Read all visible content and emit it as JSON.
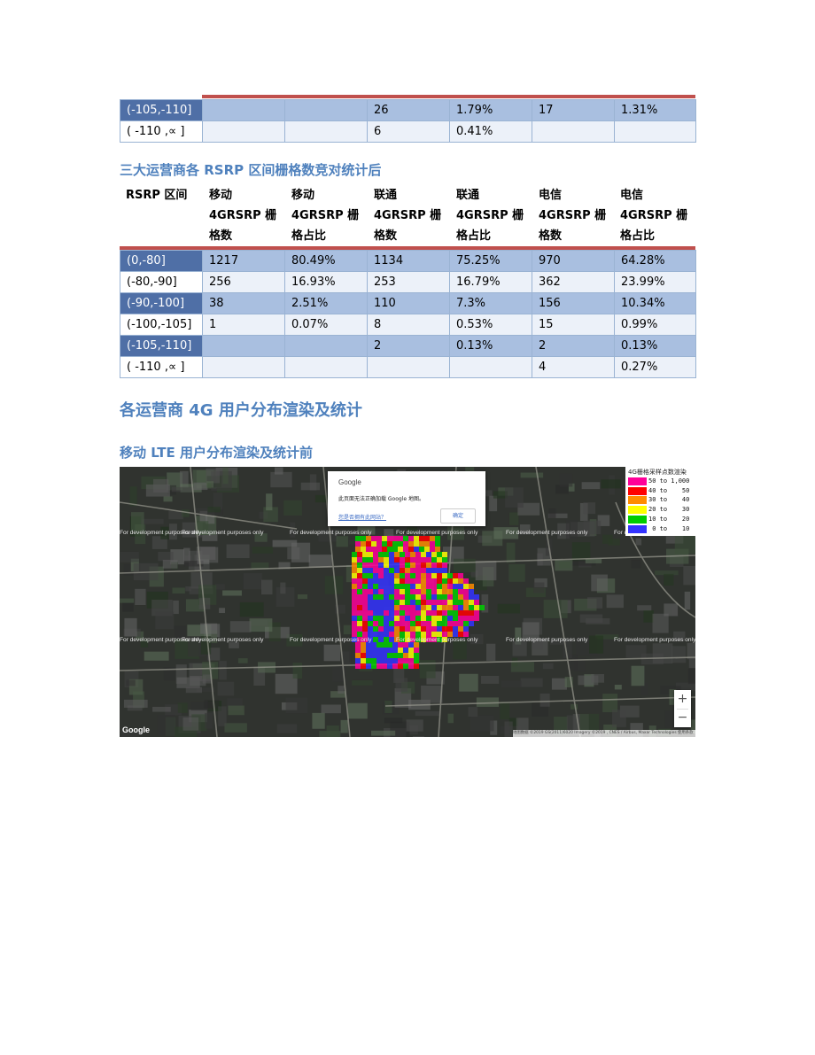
{
  "table1": {
    "rows": [
      [
        "(-105,-110]",
        "",
        "",
        "26",
        "1.79%",
        "17",
        "1.31%"
      ],
      [
        "( -110 ,∝  ]",
        "",
        "",
        "6",
        "0.41%",
        "",
        ""
      ]
    ]
  },
  "heading1": "三大运营商各 RSRP 区间栅格数竞对统计后",
  "table2": {
    "headers": [
      [
        "RSRP 区间"
      ],
      [
        "移动",
        "4GRSRP 栅",
        "格数"
      ],
      [
        "移动",
        "4GRSRP 栅",
        "格占比"
      ],
      [
        "联通",
        "4GRSRP 栅",
        "格数"
      ],
      [
        "联通",
        "4GRSRP 栅",
        "格占比"
      ],
      [
        "电信",
        "4GRSRP 栅",
        "格数"
      ],
      [
        "电信",
        "4GRSRP 栅",
        "格占比"
      ]
    ],
    "rows": [
      [
        "(0,-80]",
        "1217",
        "80.49%",
        "1134",
        "75.25%",
        "970",
        "64.28%"
      ],
      [
        "(-80,-90]",
        "256",
        "16.93%",
        "253",
        "16.79%",
        "362",
        "23.99%"
      ],
      [
        "(-90,-100]",
        "38",
        "2.51%",
        "110",
        "7.3%",
        "156",
        "10.34%"
      ],
      [
        "(-100,-105]",
        "1",
        "0.07%",
        "8",
        "0.53%",
        "15",
        "0.99%"
      ],
      [
        "(-105,-110]",
        "",
        "",
        "2",
        "0.13%",
        "2",
        "0.13%"
      ],
      [
        "( -110 ,∝  ]",
        "",
        "",
        "",
        "",
        "4",
        "0.27%"
      ]
    ]
  },
  "heading2": "各运营商 4G 用户分布渲染及统计",
  "heading3": "移动 LTE 用户分布渲染及统计前",
  "map": {
    "dialog_title": "Google",
    "dialog_message": "此页面无法正确加载 Google 地图。",
    "dialog_link": "您是否拥有此网站？",
    "dialog_ok": "确定",
    "watermark": "For development purposes only",
    "google_logo": "Google",
    "attribution": "地图数据 ©2019 GS(2011)6020 Imagery ©2019 , CNES / Airbus, Maxar Technologies   使用条款",
    "zoom_in": "+",
    "zoom_out": "−",
    "legend": {
      "title": "4G栅格采样点数渲染",
      "items": [
        {
          "label": "50 to 1,000",
          "color": "#ff0099"
        },
        {
          "label": "40 to    50",
          "color": "#ff0000"
        },
        {
          "label": "30 to    40",
          "color": "#ff8c00"
        },
        {
          "label": "20 to    30",
          "color": "#ffff00"
        },
        {
          "label": "10 to    20",
          "color": "#00cc00"
        },
        {
          "label": " 0 to    10",
          "color": "#3333ff"
        }
      ]
    }
  }
}
